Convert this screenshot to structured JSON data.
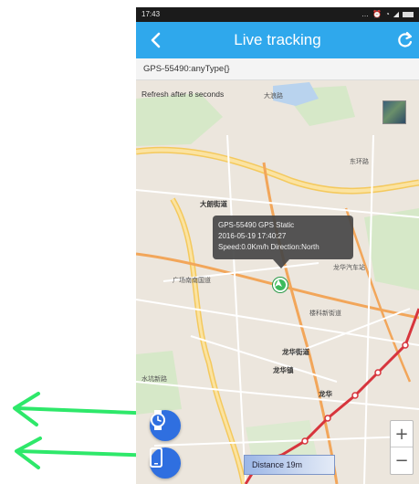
{
  "status_bar": {
    "time": "17:43",
    "icons": [
      "notification-dots",
      "alarm-icon",
      "wifi-icon",
      "signal-icon",
      "battery-icon"
    ]
  },
  "app_bar": {
    "title": "Live tracking",
    "back_icon": "back-arrow-icon",
    "refresh_icon": "refresh-icon"
  },
  "subheader": {
    "text": "GPS-55490:anyType{}"
  },
  "map": {
    "refresh_note": "Refresh after 8 seconds",
    "popup": {
      "line1": "GPS-55490 GPS Static",
      "line2": "2016-05-19 17:40:27",
      "line3": "Speed:0.0Km/h  Direction:North"
    },
    "distance": "Distance 19m",
    "zoom_in": "+",
    "zoom_out": "−",
    "labels": [
      "大朗街道",
      "龙华街道",
      "龙华镇",
      "龙华",
      "广场南南国道",
      "楼科新街道",
      "水坑新路",
      "龙华汽车站",
      "东环路",
      "大浪路"
    ]
  },
  "colors": {
    "app_bar": "#2fa8ec",
    "accent_green": "#3dbb5c",
    "fab": "#2f6fe0",
    "annotation_arrow": "#2ee86a",
    "metro_line": "#d7353d"
  }
}
